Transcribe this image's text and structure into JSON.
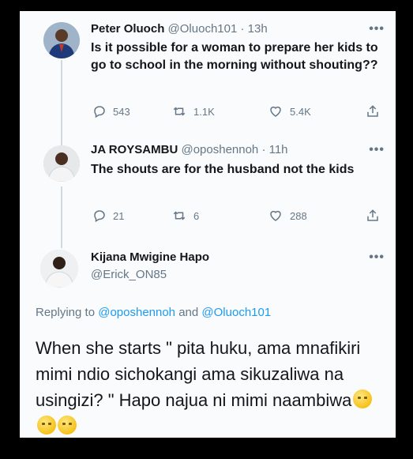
{
  "tweets": [
    {
      "name": "Peter Oluoch",
      "handle": "@Oluoch101 · 13h",
      "text": "Is it possible for a woman to prepare her kids to go to school in the morning without shouting??",
      "replies": "543",
      "retweets": "1.1K",
      "likes": "5.4K"
    },
    {
      "name": "JA ROYSAMBU",
      "handle": "@oposhennoh · 11h",
      "text": "The shouts are for the husband not the kids",
      "replies": "21",
      "retweets": "6",
      "likes": "288"
    }
  ],
  "main": {
    "name": "Kijana Mwigine Hapo",
    "handle": "@Erick_ON85",
    "replying_prefix": "Replying to",
    "replying_mention1": "@oposhennoh",
    "replying_and": "and",
    "replying_mention2": "@Oluoch101",
    "text": "When she starts \" pita huku, ama mnafikiri mimi ndio sichokangi ama sikuzaliwa na usingizi? \" Hapo najua ni mimi naambiwa"
  },
  "more_glyph": "•••",
  "icons": {
    "reply": "reply-icon",
    "retweet": "retweet-icon",
    "like": "heart-icon",
    "share": "share-icon",
    "emoji": "rolling-eyes-emoji"
  },
  "colors": {
    "background": "#000000",
    "card": "#fafbfc",
    "text": "#14171a",
    "secondary": "#657786",
    "mention": "#1d9bf0"
  }
}
